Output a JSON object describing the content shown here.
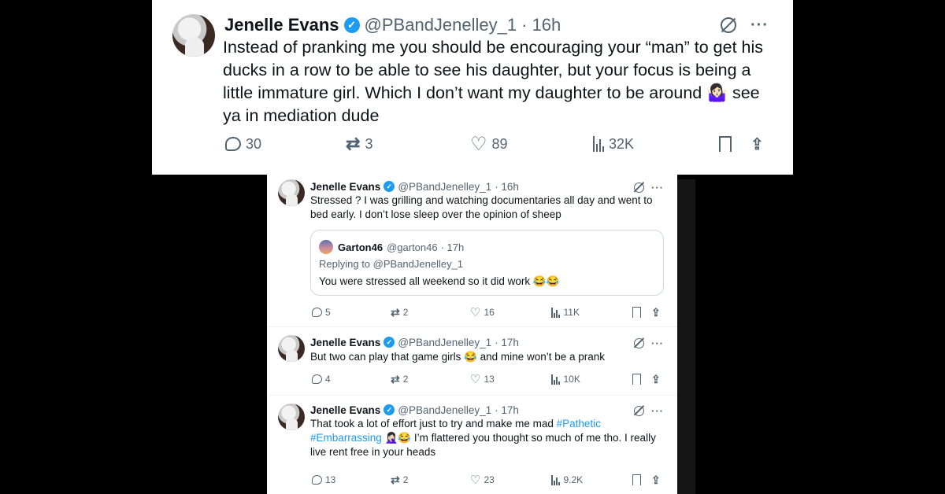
{
  "main_tweet": {
    "name": "Jenelle Evans",
    "handle": "@PBandJenelley_1",
    "time": "· 16h",
    "text": "Instead of pranking me you should be encouraging your “man” to get his ducks in a row to be able to see his daughter, but your focus is being a little immature girl. Which I don’t want my daughter to be around 🤷🏻‍♀️ see ya in mediation dude",
    "replies": "30",
    "retweets": "3",
    "likes": "89",
    "views": "32K"
  },
  "reply_tweets": [
    {
      "name": "Jenelle Evans",
      "handle": "@PBandJenelley_1",
      "time": "· 16h",
      "text": "Stressed ? I was grilling and watching documentaries all day and went to bed early. I don’t lose sleep over the opinion of sheep",
      "quote": {
        "name": "Garton46",
        "handle": "@garton46",
        "time": "· 17h",
        "replying_to": "Replying to @PBandJenelley_1",
        "text": "You were stressed all weekend so it did work 😂😂"
      },
      "replies": "5",
      "retweets": "2",
      "likes": "16",
      "views": "11K"
    },
    {
      "name": "Jenelle Evans",
      "handle": "@PBandJenelley_1",
      "time": "· 17h",
      "text": "But two can play that game girls 😂 and mine won’t be a prank",
      "replies": "4",
      "retweets": "2",
      "likes": "13",
      "views": "10K"
    },
    {
      "name": "Jenelle Evans",
      "handle": "@PBandJenelley_1",
      "time": "· 17h",
      "text_before": "That took a lot of effort just to try and make me mad ",
      "hashtag1": "#Pathetic",
      "hashtag2": "#Embarrassing",
      "text_after": " 🤦🏻‍♀️😂 I’m flattered you thought so much of me tho. I really live rent free in your heads",
      "replies": "13",
      "retweets": "2",
      "likes": "23",
      "views": "9.2K"
    }
  ],
  "icons": {
    "verified": "verified-badge-icon",
    "grok": "grok-icon",
    "more": "more-icon",
    "reply": "reply-icon",
    "retweet": "retweet-icon",
    "like": "heart-icon",
    "views": "views-icon",
    "bookmark": "bookmark-icon",
    "share": "share-icon"
  },
  "colors": {
    "accent": "#1d9bf0",
    "muted": "#536471",
    "text": "#0f1419"
  }
}
